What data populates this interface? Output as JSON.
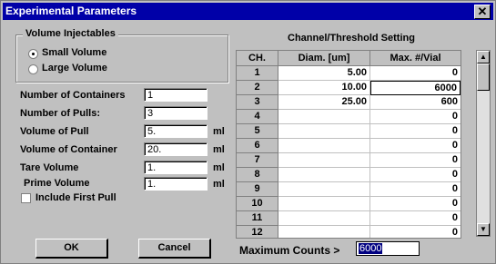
{
  "dialog": {
    "title": "Experimental Parameters",
    "close_glyph": "✕"
  },
  "volume_group": {
    "title": "Volume Injectables",
    "options": [
      {
        "label": "Small Volume",
        "selected": true
      },
      {
        "label": "Large Volume",
        "selected": false
      }
    ]
  },
  "params": [
    {
      "label": "Number of Containers",
      "value": "1",
      "unit": ""
    },
    {
      "label": "Number of Pulls:",
      "value": "3",
      "unit": ""
    },
    {
      "label": "Volume of Pull",
      "value": "5.",
      "unit": "ml"
    },
    {
      "label": "Volume of Container",
      "value": "20.",
      "unit": "ml"
    },
    {
      "label": "Tare Volume",
      "value": "1.",
      "unit": "ml"
    },
    {
      "label": "Prime Volume",
      "value": "1.",
      "unit": "ml"
    }
  ],
  "include_first_pull": {
    "label": "Include First Pull",
    "checked": false
  },
  "buttons": {
    "ok": "OK",
    "cancel": "Cancel"
  },
  "channel_table": {
    "title": "Channel/Threshold Setting",
    "headers": [
      "CH.",
      "Diam. [um]",
      "Max. #/Vial"
    ],
    "rows": [
      {
        "ch": "1",
        "diam": "5.00",
        "max": "0"
      },
      {
        "ch": "2",
        "diam": "10.00",
        "max": "6000"
      },
      {
        "ch": "3",
        "diam": "25.00",
        "max": "600"
      },
      {
        "ch": "4",
        "diam": "",
        "max": "0"
      },
      {
        "ch": "5",
        "diam": "",
        "max": "0"
      },
      {
        "ch": "6",
        "diam": "",
        "max": "0"
      },
      {
        "ch": "7",
        "diam": "",
        "max": "0"
      },
      {
        "ch": "8",
        "diam": "",
        "max": "0"
      },
      {
        "ch": "9",
        "diam": "",
        "max": "0"
      },
      {
        "ch": "10",
        "diam": "",
        "max": "0"
      },
      {
        "ch": "11",
        "diam": "",
        "max": "0"
      },
      {
        "ch": "12",
        "diam": "",
        "max": "0"
      }
    ]
  },
  "max_counts": {
    "label": "Maximum Counts >",
    "value": "6000"
  },
  "scrollbar": {
    "up_glyph": "▲",
    "down_glyph": "▼"
  }
}
